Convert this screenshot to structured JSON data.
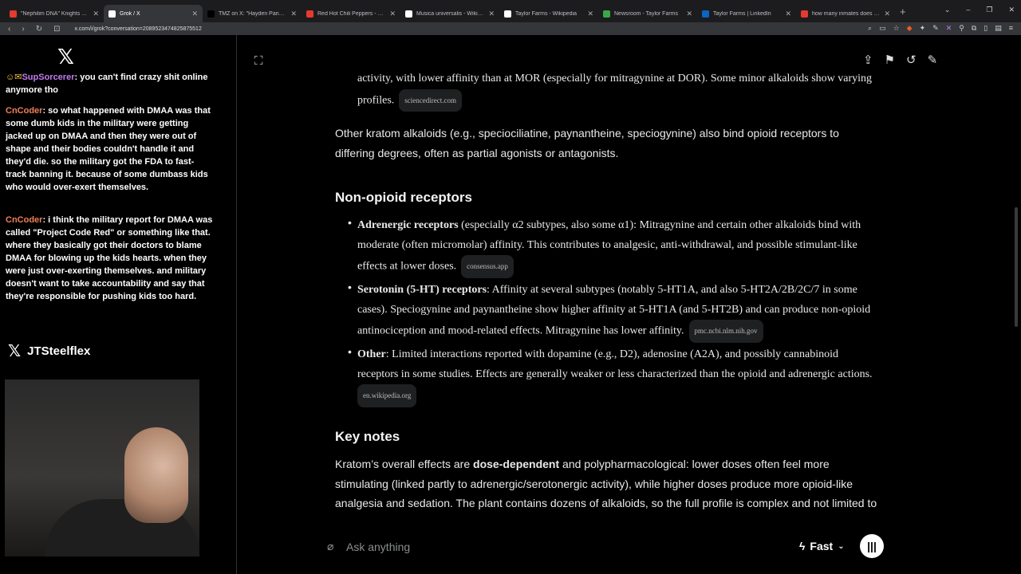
{
  "tabs": [
    {
      "title": "\"Nephilim DNA\" Knights Templar, Re",
      "color": "#e33b2e",
      "active": false
    },
    {
      "title": "Grok / X",
      "color": "#ffffff",
      "active": true
    },
    {
      "title": "TMZ on X: \"Hayden Panettiere was s",
      "color": "#000000",
      "active": false
    },
    {
      "title": "Red Hot Chili Peppers - Californicati",
      "color": "#e33b2e",
      "active": false
    },
    {
      "title": "Musica universalis - Wikipedia",
      "color": "#ffffff",
      "active": false
    },
    {
      "title": "Taylor Farms - Wikipedia",
      "color": "#ffffff",
      "active": false
    },
    {
      "title": "Newsroom - Taylor Farms",
      "color": "#3aa84a",
      "active": false
    },
    {
      "title": "Taylor Farms | LinkedIn",
      "color": "#0a66c2",
      "active": false
    },
    {
      "title": "how many inmates does taylor farm",
      "color": "#e33b2e",
      "active": false
    }
  ],
  "browser": {
    "url": "x.com/i/grok?conversation=2089523474825875512",
    "back_icon": "arrow-left-icon",
    "forward_icon": "arrow-right-icon",
    "reload_icon": "reload-icon"
  },
  "chat": {
    "messages": [
      {
        "user": "SupSorcerer",
        "text": ": you can't find crazy shit online anymore tho"
      },
      {
        "user": "CnCoder",
        "text": ": so what happened with DMAA was that some dumb kids in the military were getting jacked up on DMAA and then they were out of shape and their bodies couldn't handle it and they'd die. so the military got the FDA to fast-track banning it. because of some dumbass kids who would over-exert themselves."
      },
      {
        "user": "CnCoder",
        "text": ": i think the military report for DMAA was called \"Project Code Red\" or something like that. where they basically got their doctors to blame DMAA for blowing up the kids hearts. when they were just over-exerting themselves. and military doesn't want to take accountability and say that they're responsible for pushing kids too hard."
      }
    ],
    "handle": "JTSteelflex"
  },
  "content": {
    "para_top": "activity, with lower affinity than at MOR (especially for mitragynine at DOR). Some minor alkaloids show varying profiles.",
    "cite_top": "sciencedirect.com",
    "para_other": "Other kratom alkaloids (e.g., speciociliatine, paynantheine, speciogynine) also bind opioid receptors to differing degrees, often as partial agonists or antagonists.",
    "heading_nonopioid": "Non-opioid receptors",
    "bullet1_bold": "Adrenergic receptors",
    "bullet1_text": " (especially α2 subtypes, also some α1): Mitragynine and certain other alkaloids bind with moderate (often micromolar) affinity. This contributes to analgesic, anti-withdrawal, and possible stimulant-like effects at lower doses.",
    "bullet1_cite": "consensus.app",
    "bullet2_bold": "Serotonin (5-HT) receptors",
    "bullet2_text": ": Affinity at several subtypes (notably 5-HT1A, and also 5-HT2A/2B/2C/7 in some cases). Speciogynine and paynantheine show higher affinity at 5-HT1A (and 5-HT2B) and can produce non-opioid antinociception and mood-related effects. Mitragynine has lower affinity.",
    "bullet2_cite": "pmc.ncbi.nlm.nih.gov",
    "bullet3_bold": "Other",
    "bullet3_text": ": Limited interactions reported with dopamine (e.g., D2), adenosine (A2A), and possibly cannabinoid receptors in some studies. Effects are generally weaker or less characterized than the opioid and adrenergic actions.",
    "bullet3_cite": "en.wikipedia.org",
    "heading_keynotes": "Key notes",
    "keynotes_pre": "Kratom’s overall effects are ",
    "keynotes_bold": "dose-dependent",
    "keynotes_post": " and polypharmacological: lower doses often feel more stimulating (linked partly to adrenergic/serotonergic activity), while higher doses produce more opioid-like analgesia and sedation. The plant contains dozens of alkaloids, so the full profile is complex and not limited to"
  },
  "input": {
    "placeholder": "Ask anything",
    "mode": "Fast"
  }
}
